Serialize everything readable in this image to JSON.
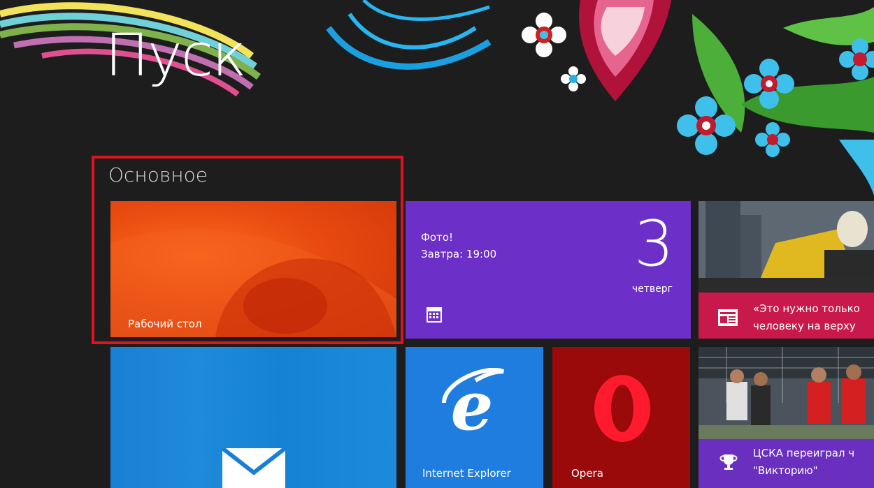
{
  "start": {
    "title": "Пуск",
    "group_label": "Основное"
  },
  "tiles": {
    "desktop": {
      "label": "Рабочий стол"
    },
    "calendar": {
      "event_title": "Фото!",
      "event_time": "Завтра: 19:00",
      "day_number": "3",
      "weekday": "четверг"
    },
    "news1": {
      "line1": "«Это нужно только",
      "line2": "человеку на верху"
    },
    "mail": {
      "icon": "mail-envelope-icon"
    },
    "ie": {
      "label": "Internet Explorer"
    },
    "opera": {
      "label": "Opera"
    },
    "news2": {
      "line1": "ЦСКА переиграл ч",
      "line2": "\"Викторию\""
    }
  },
  "colors": {
    "background": "#1d1d1d",
    "desktop_tile": "#e84a10",
    "calendar_tile": "#6c2fc7",
    "news_bar": "#c8194a",
    "mail_tile": "#1a7fd4",
    "ie_tile": "#1f7de0",
    "opera_tile": "#9b0a0a",
    "sport_bar": "#6a2fbf",
    "highlight": "#e0141e"
  }
}
